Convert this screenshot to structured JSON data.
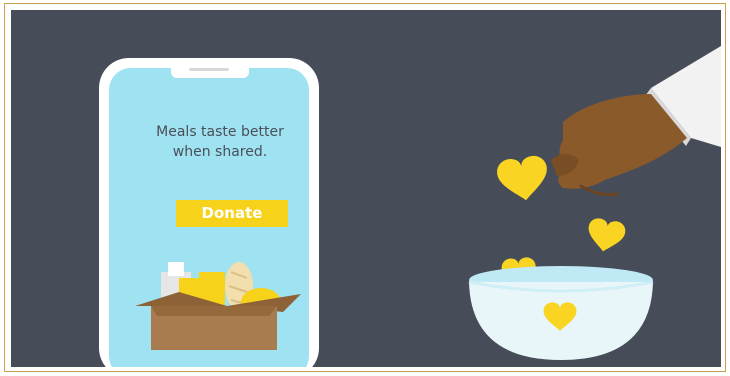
{
  "phone": {
    "tagline_line1": "Meals taste better",
    "tagline_line2": "when shared.",
    "donate_label": "Donate"
  },
  "colors": {
    "background": "#474d58",
    "screen": "#9fe3f2",
    "accent_yellow": "#f7d21a",
    "heart": "#f9d423",
    "bowl": "#e8f6fa",
    "box": "#a87c4f",
    "skin": "#8a5a2b",
    "sleeve": "#f2f2f2",
    "border": "#c9a24a"
  },
  "icons": [
    "heart-icon",
    "hand-illustration",
    "bowl-illustration",
    "grocery-box-illustration"
  ]
}
